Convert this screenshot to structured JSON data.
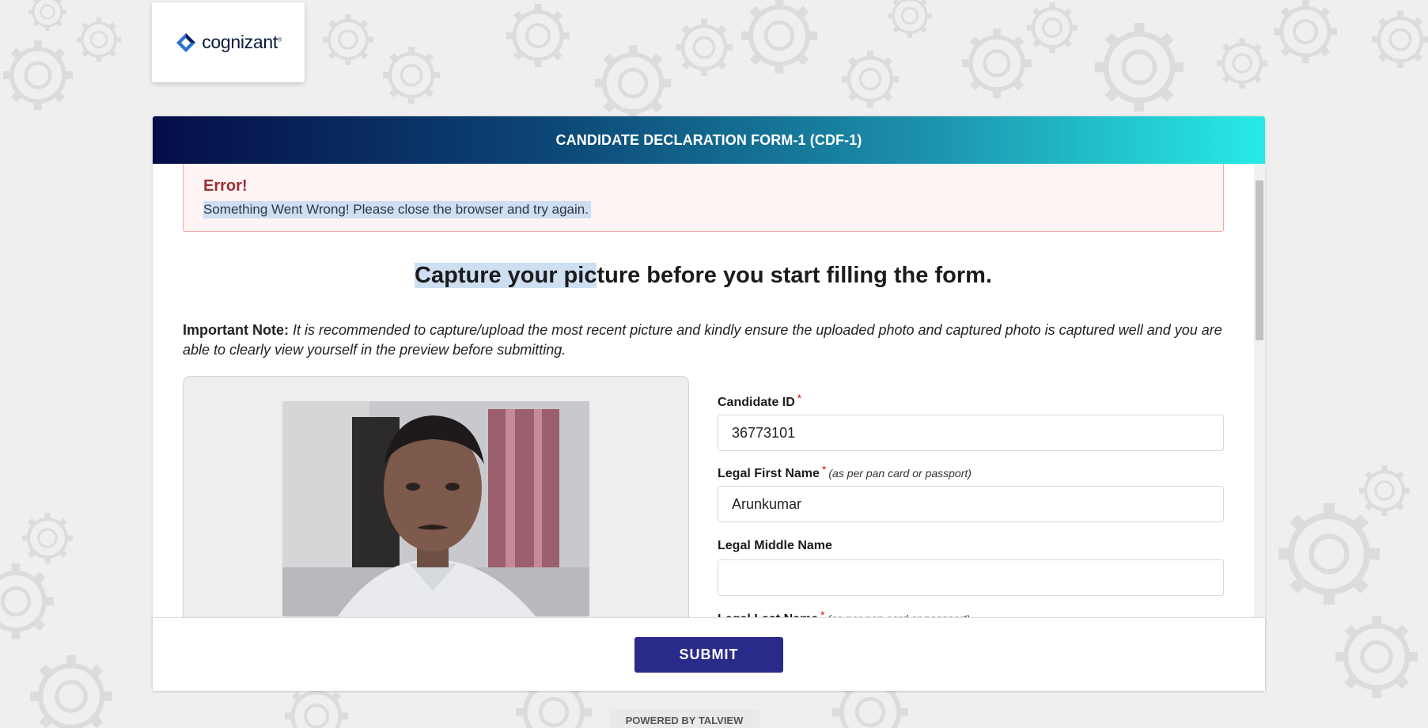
{
  "brand": {
    "logo_text": "cognizant",
    "trademark": "®"
  },
  "form": {
    "title": "CANDIDATE DECLARATION FORM-1 (CDF-1)"
  },
  "error": {
    "title": "Error!",
    "message": "Something Went Wrong! Please close the browser and try again."
  },
  "capture": {
    "heading_selected": "Capture your pic",
    "heading_rest": "ture before you start filling the form."
  },
  "note": {
    "label": "Important Note:",
    "text": "It is recommended to capture/upload the most recent picture and kindly ensure the uploaded photo and captured photo is captured well and you are able to clearly view yourself in the preview before submitting."
  },
  "fields": {
    "candidate_id": {
      "label": "Candidate ID",
      "required_mark": "*",
      "value": "36773101"
    },
    "first_name": {
      "label": "Legal First Name",
      "required_mark": "*",
      "hint": "(as per pan card or passport)",
      "value": "Arunkumar"
    },
    "middle_name": {
      "label": "Legal Middle Name",
      "value": ""
    },
    "last_name": {
      "label": "Legal Last Name",
      "required_mark": "*",
      "hint": "(as per pan card or passport)"
    }
  },
  "submit": {
    "label": "SUBMIT"
  },
  "footer": {
    "powered_by": "POWERED BY TALVIEW"
  },
  "icons": {
    "logo": "cognizant-logo-icon",
    "photo": "webcam-photo"
  },
  "colors": {
    "header_gradient_start": "#050d47",
    "header_gradient_end": "#27ebe6",
    "error_text": "#9b2b35",
    "submit_bg": "#2a2a8a",
    "required": "#dd1111"
  }
}
